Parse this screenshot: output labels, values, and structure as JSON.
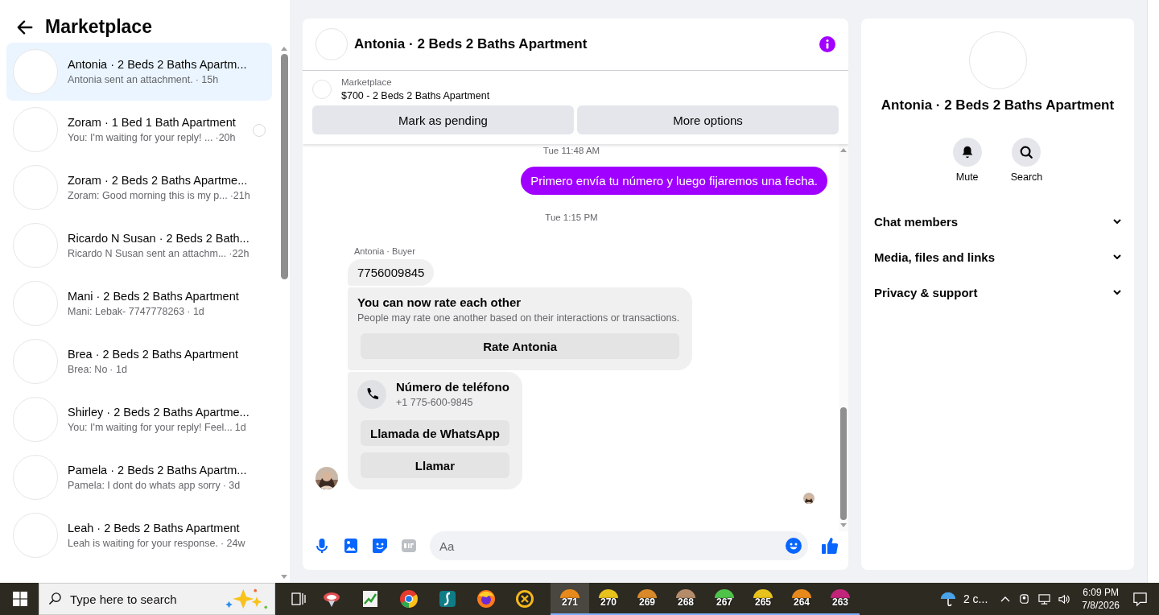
{
  "sidebar": {
    "title": "Marketplace",
    "conversations": [
      {
        "name": "Antonia · 2 Beds 2 Baths Apartm...",
        "preview": "Antonia sent an attachment.",
        "time": "· 15h",
        "selected": true,
        "read_receipt": false
      },
      {
        "name": "Zoram · 1 Bed 1 Bath Apartment",
        "preview": "You: I'm waiting for your reply! ...",
        "time": "·20h",
        "selected": false,
        "read_receipt": true
      },
      {
        "name": "Zoram · 2 Beds 2 Baths Apartme...",
        "preview": "Zoram: Good morning this is my p...",
        "time": "·21h",
        "selected": false,
        "read_receipt": false
      },
      {
        "name": "Ricardo N Susan · 2 Beds 2 Bath...",
        "preview": "Ricardo N Susan sent an attachm...",
        "time": "·22h",
        "selected": false,
        "read_receipt": false
      },
      {
        "name": "Mani · 2 Beds 2 Baths Apartment",
        "preview": "Mani: Lebak- 7747778263",
        "time": "· 1d",
        "selected": false,
        "read_receipt": false
      },
      {
        "name": "Brea · 2 Beds 2 Baths Apartment",
        "preview": "Brea: No",
        "time": "· 1d",
        "selected": false,
        "read_receipt": false
      },
      {
        "name": "Shirley · 2 Beds 2 Baths Apartme...",
        "preview": "You: I'm waiting for your reply! Feel...",
        "time": "1d",
        "selected": false,
        "read_receipt": false
      },
      {
        "name": "Pamela · 2 Beds 2 Baths Apartm...",
        "preview": "Pamela: I dont do whats app sorry",
        "time": "· 3d",
        "selected": false,
        "read_receipt": false
      },
      {
        "name": "Leah · 2 Beds 2 Baths Apartment",
        "preview": "Leah is waiting for your response.",
        "time": "· 24w",
        "selected": false,
        "read_receipt": false
      }
    ]
  },
  "chat": {
    "title": "Antonia · 2 Beds 2 Baths Apartment",
    "listing": {
      "label": "Marketplace",
      "title": "$700 - 2 Beds 2 Baths Apartment"
    },
    "actions": [
      "Mark as pending",
      "More options"
    ],
    "messages": [
      {
        "kind": "timestamp",
        "text": "Tue 11:48 AM"
      },
      {
        "kind": "outgoing",
        "text": "Primero envía tu número y luego fijaremos una fecha."
      },
      {
        "kind": "timestamp",
        "text": "Tue 1:15 PM"
      },
      {
        "kind": "incoming_group",
        "sender": "Antonia · Buyer",
        "items": [
          {
            "kind": "text",
            "text": "7756009845"
          },
          {
            "kind": "rating",
            "title": "You can now rate each other",
            "description": "People may rate one another based on their interactions or transactions.",
            "button": "Rate Antonia"
          },
          {
            "kind": "contact",
            "title": "Número de teléfono",
            "phone": "+1 775-600-9845",
            "buttons": [
              "Llamada de WhatsApp",
              "Llamar"
            ]
          }
        ]
      }
    ],
    "composer": {
      "placeholder": "Aa"
    }
  },
  "details": {
    "title": "Antonia · 2 Beds 2 Baths Apartment",
    "actions": [
      {
        "kind": "mute",
        "label": "Mute"
      },
      {
        "kind": "search",
        "label": "Search"
      }
    ],
    "sections": [
      {
        "label": "Chat members",
        "expanded": false
      },
      {
        "label": "Media, files and links",
        "expanded": false
      },
      {
        "label": "Privacy & support",
        "expanded": false
      }
    ]
  },
  "taskbar": {
    "search_placeholder": "Type here to search",
    "counters": [
      {
        "label": "271",
        "color": "#e8891c",
        "selected": true
      },
      {
        "label": "270",
        "color": "#e8c21c",
        "selected": false
      },
      {
        "label": "269",
        "color": "#d9892a",
        "selected": false
      },
      {
        "label": "268",
        "color": "#b58c6a",
        "selected": false
      },
      {
        "label": "267",
        "color": "#4fc24a",
        "selected": false
      },
      {
        "label": "265",
        "color": "#e8c21c",
        "selected": false
      },
      {
        "label": "264",
        "color": "#e8891c",
        "selected": false
      },
      {
        "label": "263",
        "color": "#c2247a",
        "selected": false
      }
    ],
    "weather": "2 c...",
    "time": "6:09 PM",
    "date": "7/8/2026"
  }
}
